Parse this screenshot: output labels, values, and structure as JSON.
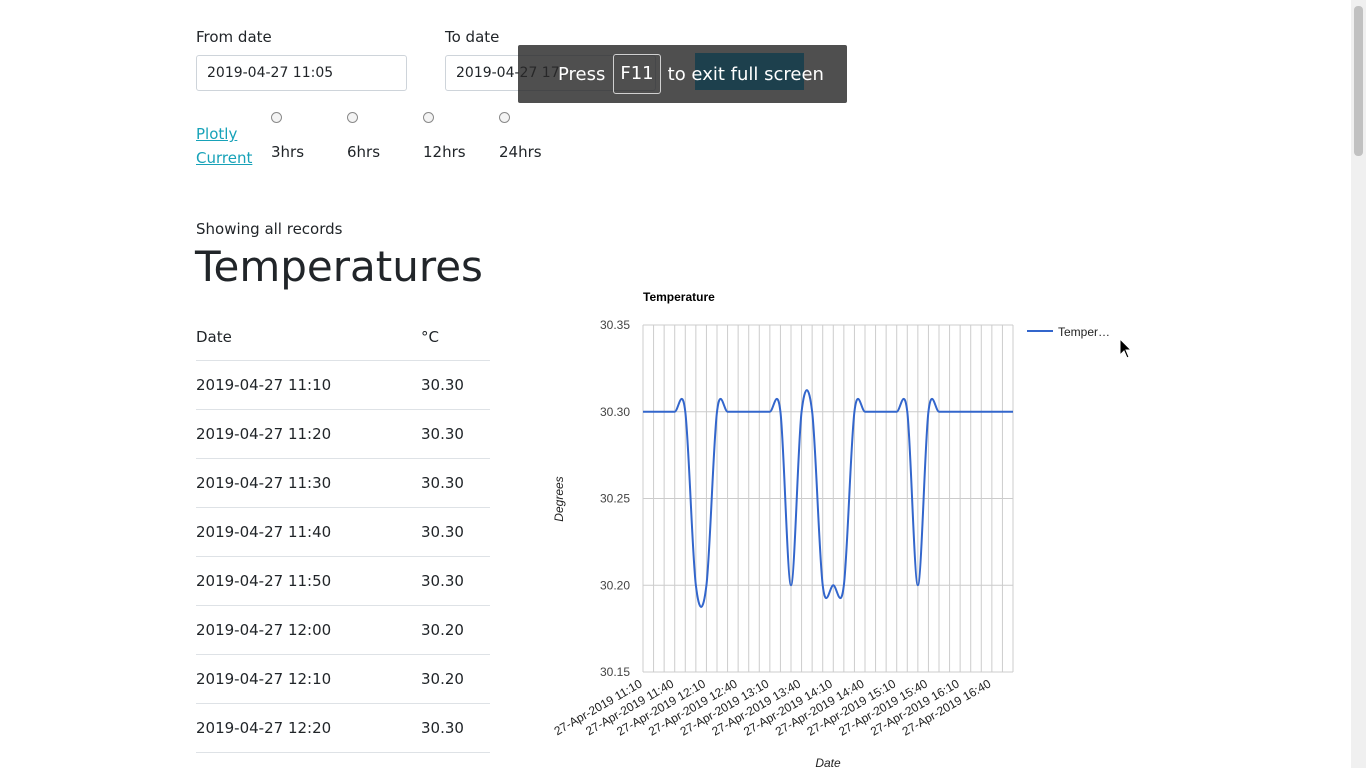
{
  "filters": {
    "from_label": "From date",
    "from_value": "2019-04-27 11:05",
    "to_label": "To date",
    "to_value": "2019-04-27 17:",
    "links": [
      "Plotly",
      "Current"
    ],
    "ranges": [
      "3hrs",
      "6hrs",
      "12hrs",
      "24hrs"
    ]
  },
  "fullscreen": {
    "press": "Press",
    "key": "F11",
    "rest": "to exit full screen"
  },
  "status": "Showing all records",
  "heading": "Temperatures",
  "table": {
    "headers": [
      "Date",
      "°C"
    ],
    "rows": [
      [
        "2019-04-27 11:10",
        "30.30"
      ],
      [
        "2019-04-27 11:20",
        "30.30"
      ],
      [
        "2019-04-27 11:30",
        "30.30"
      ],
      [
        "2019-04-27 11:40",
        "30.30"
      ],
      [
        "2019-04-27 11:50",
        "30.30"
      ],
      [
        "2019-04-27 12:00",
        "30.20"
      ],
      [
        "2019-04-27 12:10",
        "30.20"
      ],
      [
        "2019-04-27 12:20",
        "30.30"
      ]
    ]
  },
  "colors": {
    "series": "#3366cc",
    "link": "#17a2b8"
  },
  "chart_data": {
    "type": "line",
    "title": "Temperature",
    "xlabel": "Date",
    "ylabel": "Degrees",
    "ylim": [
      30.15,
      30.35
    ],
    "yticks": [
      "30.35",
      "30.30",
      "30.25",
      "30.20",
      "30.15"
    ],
    "xticks": [
      "27-Apr-2019 11:10",
      "27-Apr-2019 11:40",
      "27-Apr-2019 12:10",
      "27-Apr-2019 12:40",
      "27-Apr-2019 13:10",
      "27-Apr-2019 13:40",
      "27-Apr-2019 14:10",
      "27-Apr-2019 14:40",
      "27-Apr-2019 15:10",
      "27-Apr-2019 15:40",
      "27-Apr-2019 16:10",
      "27-Apr-2019 16:40"
    ],
    "grid": true,
    "legend_position": "right",
    "series": [
      {
        "name": "Temper…",
        "x": [
          "11:10",
          "11:20",
          "11:30",
          "11:40",
          "11:50",
          "12:00",
          "12:10",
          "12:20",
          "12:30",
          "12:40",
          "12:50",
          "13:00",
          "13:10",
          "13:20",
          "13:30",
          "13:40",
          "13:50",
          "14:00",
          "14:10",
          "14:20",
          "14:30",
          "14:40",
          "14:50",
          "15:00",
          "15:10",
          "15:20",
          "15:30",
          "15:40",
          "15:50",
          "16:00",
          "16:10",
          "16:20",
          "16:30",
          "16:40",
          "16:50",
          "17:00"
        ],
        "values": [
          30.3,
          30.3,
          30.3,
          30.3,
          30.3,
          30.2,
          30.2,
          30.3,
          30.3,
          30.3,
          30.3,
          30.3,
          30.3,
          30.3,
          30.2,
          30.3,
          30.3,
          30.2,
          30.2,
          30.2,
          30.3,
          30.3,
          30.3,
          30.3,
          30.3,
          30.3,
          30.2,
          30.3,
          30.3,
          30.3,
          30.3,
          30.3,
          30.3,
          30.3,
          30.3,
          30.3
        ]
      }
    ]
  }
}
